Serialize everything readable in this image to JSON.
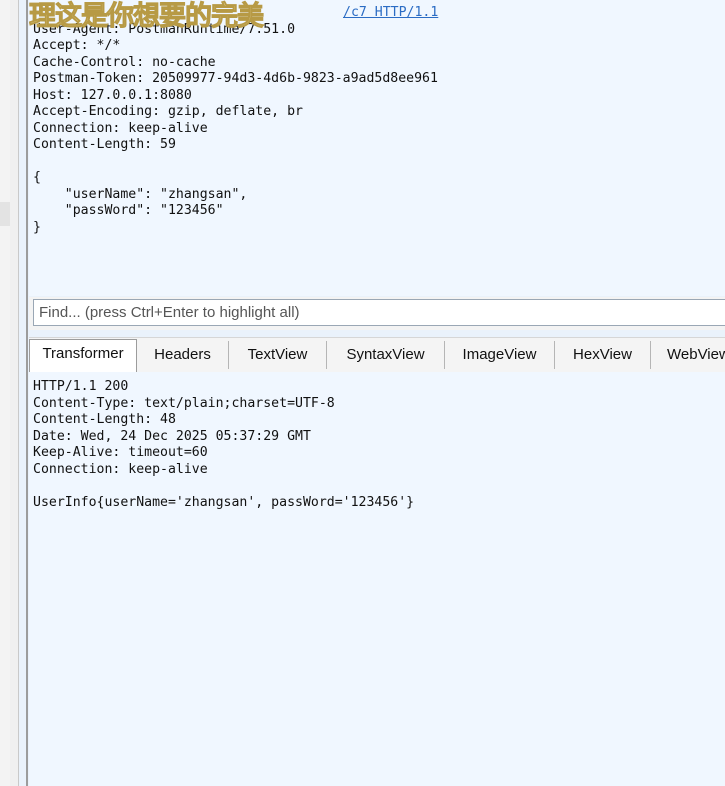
{
  "request": {
    "link_text": "/c7 HTTP/1.1",
    "lines": [
      "",
      "User-Agent: PostmanRuntime/7.51.0",
      "Accept: */*",
      "Cache-Control: no-cache",
      "Postman-Token: 20509977-94d3-4d6b-9823-a9ad5d8ee961",
      "Host: 127.0.0.1:8080",
      "Accept-Encoding: gzip, deflate, br",
      "Connection: keep-alive",
      "Content-Length: 59",
      "",
      "{",
      "    \"userName\": \"zhangsan\",",
      "    \"passWord\": \"123456\"",
      "}"
    ]
  },
  "watermark": "理这是你想要的完美",
  "find": {
    "placeholder": "Find... (press Ctrl+Enter to highlight all)"
  },
  "tabs": [
    {
      "label": "Transformer"
    },
    {
      "label": "Headers"
    },
    {
      "label": "TextView"
    },
    {
      "label": "SyntaxView"
    },
    {
      "label": "ImageView"
    },
    {
      "label": "HexView"
    },
    {
      "label": "WebView"
    }
  ],
  "response": {
    "lines": [
      "HTTP/1.1 200",
      "Content-Type: text/plain;charset=UTF-8",
      "Content-Length: 48",
      "Date: Wed, 24 Dec 2025 05:37:29 GMT",
      "Keep-Alive: timeout=60",
      "Connection: keep-alive",
      "",
      "UserInfo{userName='zhangsan', passWord='123456'}"
    ]
  }
}
